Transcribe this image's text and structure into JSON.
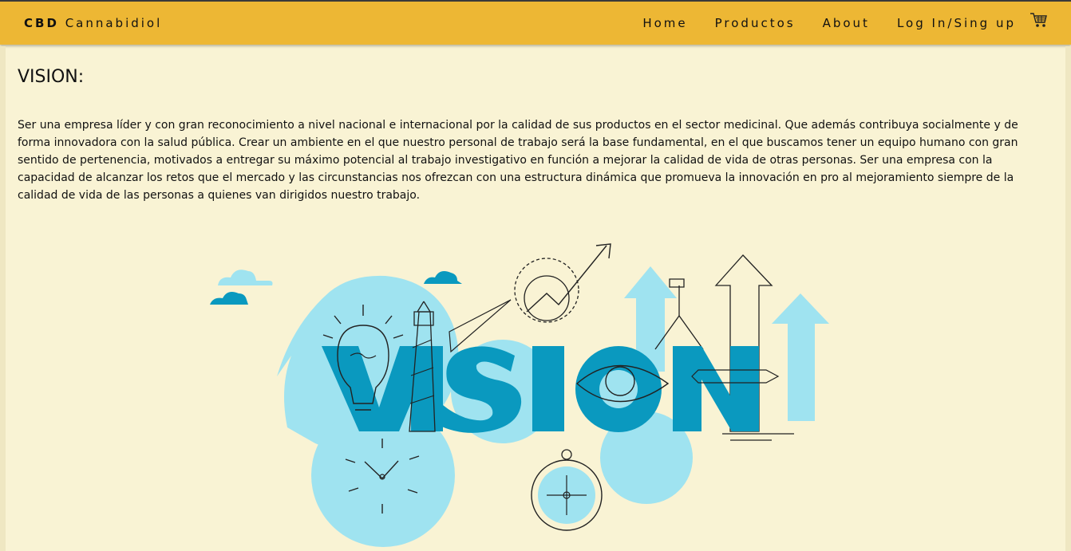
{
  "nav": {
    "brand_bold": "CBD",
    "brand_rest": "Cannabidiol",
    "links": [
      "Home",
      "Productos",
      "About",
      "Log In/Sing up"
    ],
    "cart_icon": "shopping-cart-icon"
  },
  "main": {
    "heading": "VISION:",
    "paragraph": "Ser una empresa líder y con gran reconocimiento a nivel nacional e internacional por la calidad de sus productos en el sector medicinal. Que además contribuya socialmente y de forma innovadora con la salud pública. Crear un ambiente en el que nuestro personal de trabajo será la base fundamental, en el que buscamos tener un equipo humano con gran sentido de pertenencia, motivados a entregar su máximo potencial al trabajo investigativo en función a mejorar la calidad de vida de otras personas. Ser una empresa con la capacidad de alcanzar los retos que el mercado y las circunstancias nos ofrezcan con una estructura dinámica que promueva la innovación en pro al mejoramiento siempre de la calidad de vida de las personas a quienes van dirigidos nuestro trabajo.",
    "illustration_word": "VISION"
  },
  "colors": {
    "navbar": "#edb734",
    "page_bg": "#f9f3d4",
    "light_blue": "#9fe3f0",
    "dark_blue": "#0a99bf"
  }
}
